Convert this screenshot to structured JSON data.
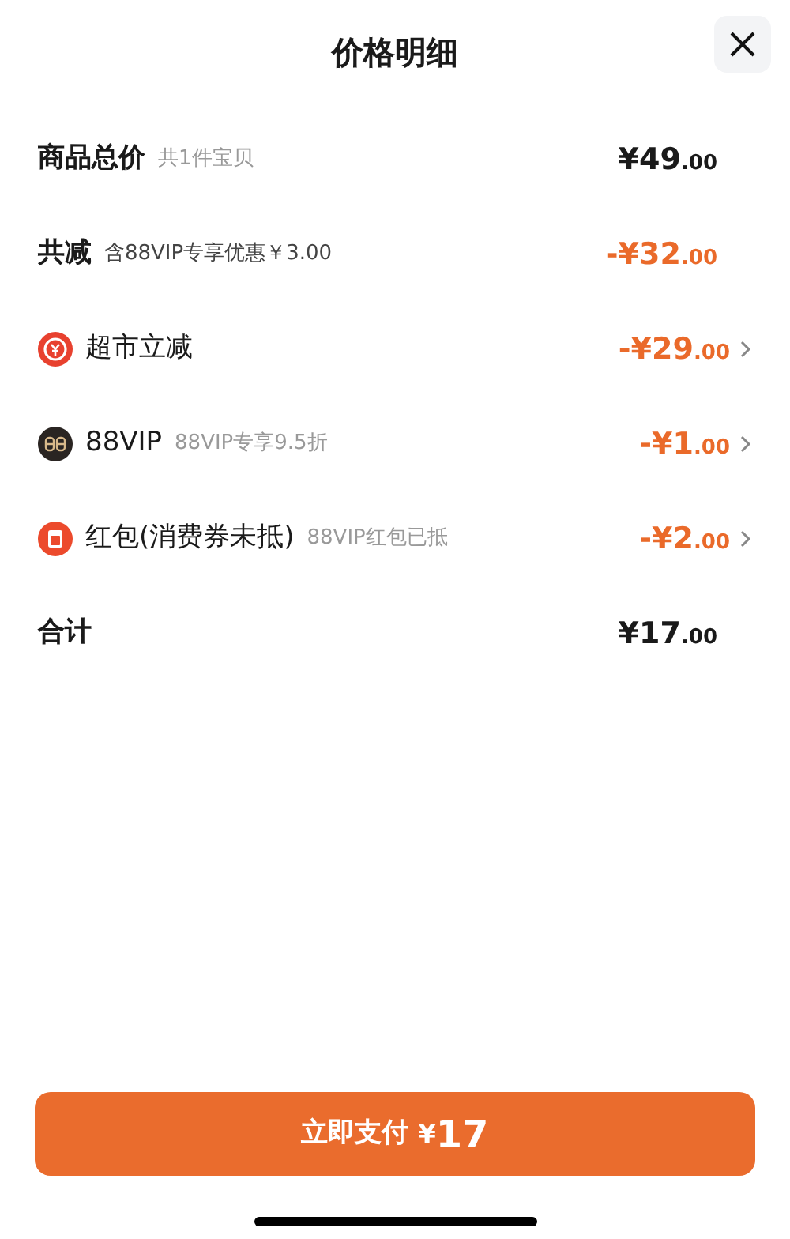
{
  "title": "价格明细",
  "rows": [
    {
      "kind": "subtotal",
      "label": "商品总价",
      "note": "共1件宝贝",
      "amount": "¥49",
      "cents": ".00"
    },
    {
      "kind": "savings",
      "label": "共减",
      "note": "含88VIP专享优惠￥3.00",
      "amount": "-¥32",
      "cents": ".00"
    },
    {
      "kind": "store_discount",
      "label": "超市立减",
      "amount": "-¥29",
      "cents": ".00"
    },
    {
      "kind": "vip_discount",
      "label": "88VIP",
      "note": "88VIP专享9.5折",
      "amount": "-¥1",
      "cents": ".00"
    },
    {
      "kind": "packet_discount",
      "label": "红包(消费券未抵)",
      "note": "88VIP红包已抵",
      "amount": "-¥2",
      "cents": ".00"
    },
    {
      "kind": "total",
      "label": "合计",
      "amount": "¥17",
      "cents": ".00"
    }
  ],
  "pay_button": {
    "label": "立即支付",
    "amount_symbol": "¥",
    "amount": "17"
  }
}
